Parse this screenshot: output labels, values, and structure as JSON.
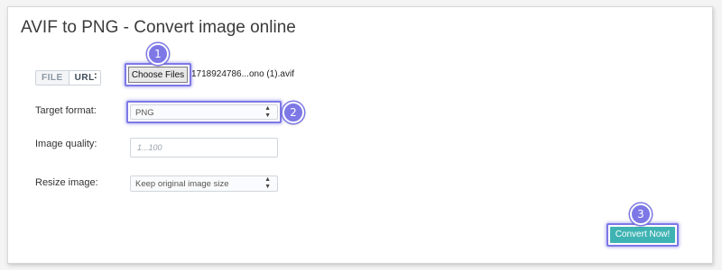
{
  "page": {
    "title": "AVIF to PNG - Convert image online"
  },
  "source": {
    "toggle_file": "FILE",
    "toggle_url": "URL",
    "colon": ":",
    "choose_label": "Choose Files",
    "file_name": "1718924786...ono (1).avif"
  },
  "target_format": {
    "label": "Target format:",
    "value": "PNG"
  },
  "image_quality": {
    "label": "Image quality:",
    "placeholder": "1...100"
  },
  "resize_image": {
    "label": "Resize image:",
    "value": "Keep original image size"
  },
  "actions": {
    "convert_label": "Convert Now!"
  },
  "steps": [
    "1",
    "2",
    "3"
  ],
  "colors": {
    "accent_highlight": "#7d78e6",
    "convert_button": "#3fb3b3"
  },
  "icons": {
    "select_arrows": "up-down-chevron-icon"
  }
}
